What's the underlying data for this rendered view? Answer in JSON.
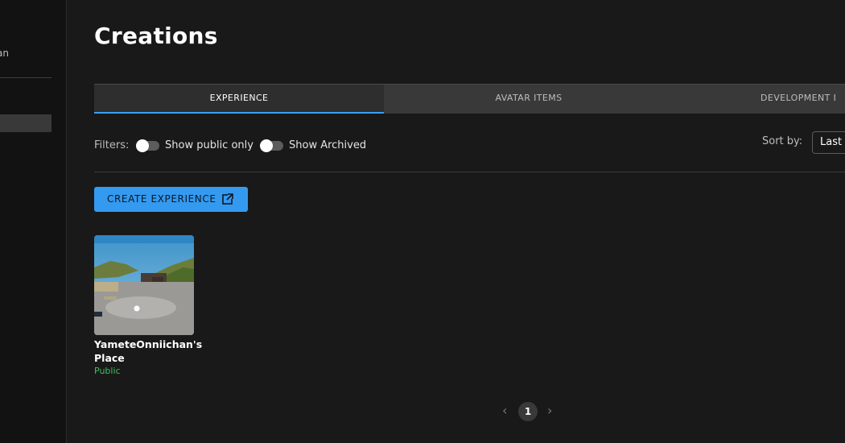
{
  "sidebar": {
    "user_fragment": "an"
  },
  "page": {
    "title": "Creations"
  },
  "tabs": [
    {
      "label": "EXPERIENCE",
      "active": true
    },
    {
      "label": "AVATAR ITEMS",
      "active": false
    },
    {
      "label": "DEVELOPMENT I",
      "active": false
    }
  ],
  "filters": {
    "label": "Filters:",
    "toggles": [
      {
        "label": "Show public only",
        "on": false
      },
      {
        "label": "Show Archived",
        "on": false
      }
    ]
  },
  "sort": {
    "label": "Sort by:",
    "selected": "Last"
  },
  "create_button": {
    "label": "CREATE EXPERIENCE",
    "icon": "external-link-icon",
    "color": "#339af0"
  },
  "experiences": [
    {
      "name": "YameteOnniichan's Place",
      "status": "Public",
      "status_color": "#3fbf5f"
    }
  ],
  "pagination": {
    "current": "1",
    "prev_icon": "chevron-left-icon",
    "next_icon": "chevron-right-icon"
  }
}
